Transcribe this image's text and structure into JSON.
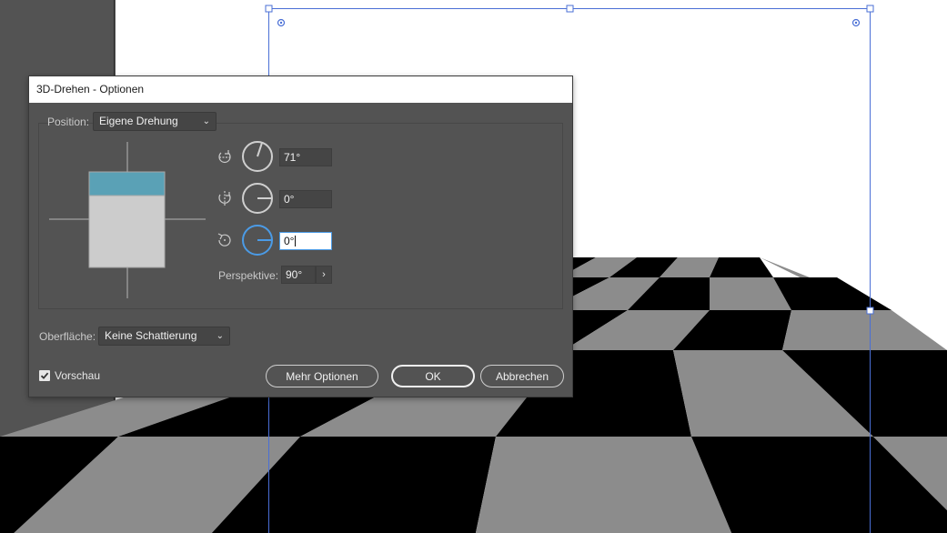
{
  "dialog": {
    "title": "3D-Drehen - Optionen",
    "position_label": "Position:",
    "position_value": "Eigene Drehung",
    "x_rotation": "71°",
    "y_rotation": "0°",
    "z_rotation": "0°",
    "perspective_label": "Perspektive:",
    "perspective_value": "90°",
    "surface_label": "Oberfläche:",
    "surface_value": "Keine Schattierung",
    "preview_label": "Vorschau",
    "preview_checked": true,
    "more_options_label": "Mehr Optionen",
    "ok_label": "OK",
    "cancel_label": "Abbrechen"
  },
  "colors": {
    "dialog_bg": "#535353",
    "accent": "#4b9be6",
    "cube_top": "#5aa1b6",
    "cube_front": "#cccccc",
    "checker_dark": "#000000",
    "checker_light": "#8c8c8c",
    "selection": "#4a6fd6"
  }
}
